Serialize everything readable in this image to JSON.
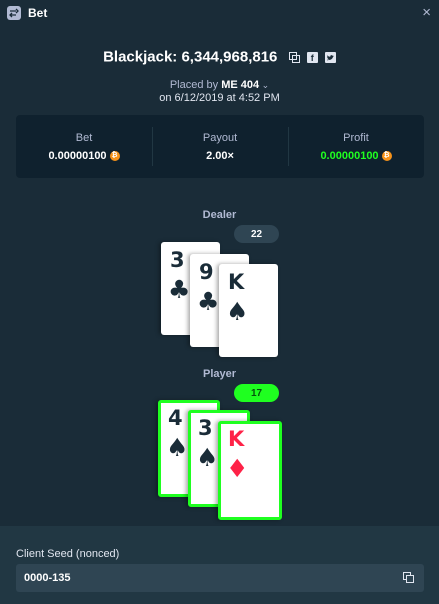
{
  "window": {
    "title": "Bet",
    "close_icon": "close-icon"
  },
  "header": {
    "game_label": "Blackjack:",
    "bet_id": "6,344,968,816",
    "icons": [
      "copy-icon",
      "facebook-icon",
      "twitter-icon"
    ],
    "facebook_glyph": "f"
  },
  "placed": {
    "prefix": "Placed by",
    "user": "ME 404",
    "date_line": "on 6/12/2019 at 4:52 PM"
  },
  "stats": {
    "bet_label": "Bet",
    "bet_value": "0.00000100",
    "payout_label": "Payout",
    "payout_value": "2.00×",
    "profit_label": "Profit",
    "profit_value": "0.00000100",
    "currency_icon": "bitcoin-icon",
    "coin_glyph": "₿"
  },
  "dealer": {
    "label": "Dealer",
    "score": "22",
    "cards": [
      {
        "rank": "3",
        "suit": "♣"
      },
      {
        "rank": "9",
        "suit": "♣"
      },
      {
        "rank": "K",
        "suit": "♠"
      }
    ]
  },
  "player": {
    "label": "Player",
    "score": "17",
    "cards": [
      {
        "rank": "4",
        "suit": "♠"
      },
      {
        "rank": "3",
        "suit": "♠"
      },
      {
        "rank": "K",
        "suit": "♦"
      }
    ]
  },
  "colors": {
    "background": "#1a2c38",
    "panel": "#0f212e",
    "win_green": "#1fff20",
    "red_suit": "#fe2247",
    "bitcoin": "#f7931a"
  },
  "footer": {
    "client_seed_label": "Client Seed (nonced)",
    "client_seed_value": "0000-135"
  }
}
